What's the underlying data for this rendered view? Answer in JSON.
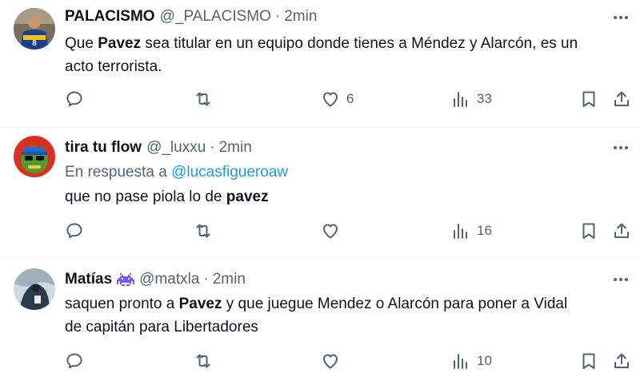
{
  "tweets": [
    {
      "name": "PALACISMO",
      "handle": "@_PALACISMO",
      "dot": "·",
      "time": "2min",
      "body_parts": [
        "Que ",
        "Pavez",
        " sea titular en un equipo donde tienes a Méndez y Alarcón, es un",
        "acto terrorista."
      ],
      "likes": "6",
      "views": "33",
      "icons": {
        "reply": "reply-icon",
        "retweet": "retweet-icon",
        "like": "heart-icon",
        "views": "views-icon",
        "bookmark": "bookmark-icon",
        "share": "share-icon",
        "more": "more-icon"
      }
    },
    {
      "name": "tira tu flow",
      "handle": "@_luxxu",
      "dot": "·",
      "time": "2min",
      "reply_prefix": "En respuesta a",
      "reply_link": "@lucasfigueroaw",
      "body_parts": [
        "que no pase piola lo de ",
        "pavez"
      ],
      "views": "16"
    },
    {
      "name": "Matías",
      "handle": "@matxla",
      "dot": "·",
      "time": "2min",
      "badge": "space-invader-icon",
      "body_parts": [
        "saquen pronto a ",
        "Pavez",
        " y que juegue Mendez o Alarcón para poner a Vidal",
        "de capitán para Libertadores"
      ],
      "views": "10"
    }
  ],
  "colors": {
    "text": "#0f1419",
    "muted": "#536471",
    "link": "#1d9bf0",
    "divider": "#eff3f4",
    "badge": "#7856ff"
  }
}
